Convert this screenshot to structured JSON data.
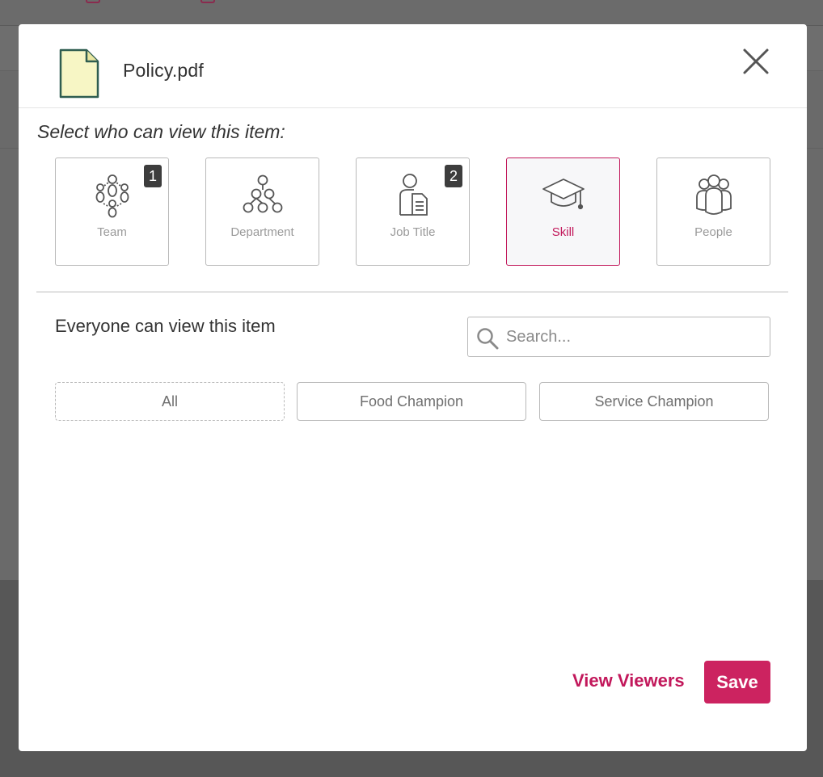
{
  "colors": {
    "accent": "#c2185b",
    "save_bg": "#cc2360",
    "file_fill": "#f7f6c5",
    "file_stroke": "#2f5d50",
    "icon_stroke": "#555555"
  },
  "header": {
    "file_icon": "document-icon",
    "file_name": "Policy.pdf",
    "close_icon": "close-icon"
  },
  "prompt": "Select who can view this item:",
  "options": [
    {
      "label": "Team",
      "icon": "team-icon",
      "badge": "1",
      "selected": false
    },
    {
      "label": "Department",
      "icon": "department-icon",
      "badge": "",
      "selected": false
    },
    {
      "label": "Job Title",
      "icon": "job-title-icon",
      "badge": "2",
      "selected": false
    },
    {
      "label": "Skill",
      "icon": "graduation-cap-icon",
      "badge": "",
      "selected": true
    },
    {
      "label": "People",
      "icon": "people-icon",
      "badge": "",
      "selected": false
    }
  ],
  "everyone_text": "Everyone can view this item",
  "search": {
    "placeholder": "Search...",
    "value": "",
    "icon": "search-icon"
  },
  "chips": [
    {
      "label": "All",
      "style": "dashed"
    },
    {
      "label": "Food Champion",
      "style": "solid"
    },
    {
      "label": "Service Champion",
      "style": "solid"
    }
  ],
  "footer": {
    "view_viewers_label": "View Viewers",
    "save_label": "Save"
  }
}
